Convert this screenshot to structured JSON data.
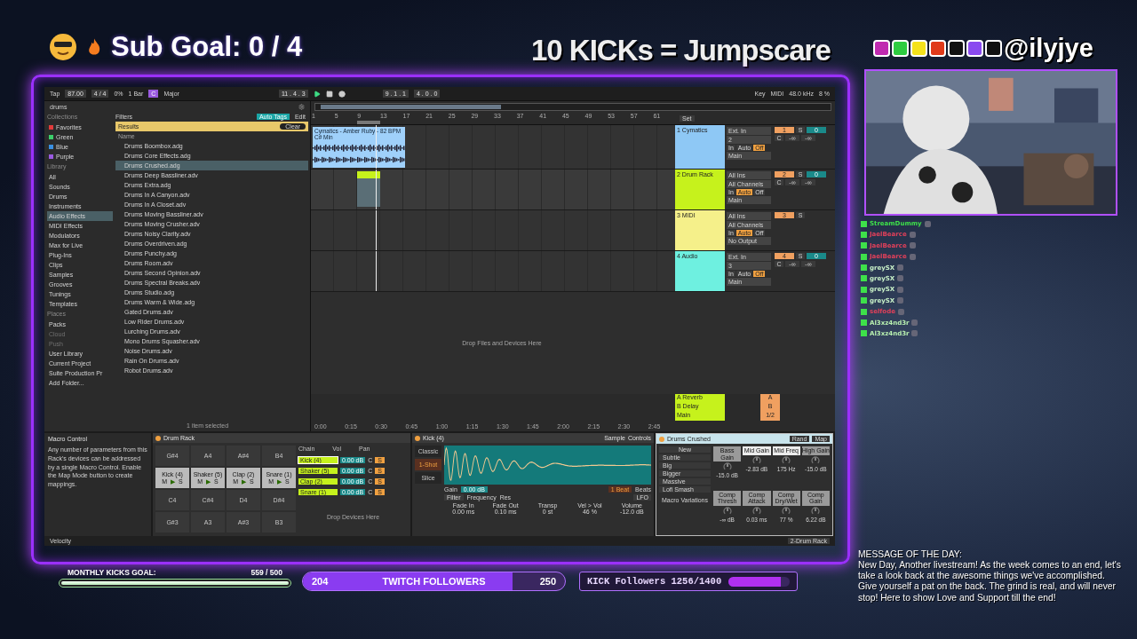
{
  "overlay": {
    "sub_goal": "Sub Goal:  0 / 4",
    "headline": "10 KICKs = Jumpscare",
    "handle": "@ilyjye"
  },
  "transport": {
    "tap": "Tap",
    "tempo": "87.00",
    "signature": "4 / 4",
    "swing": "0%",
    "quantize": "1 Bar",
    "key": "C",
    "scale": "Major",
    "position": "11 .  4 .  3",
    "loop_start": "9 .  1 .  1",
    "loop_length": "4 .  0 .  0",
    "key_label": "Key",
    "midi_label": "MIDI",
    "sample_rate": "48.0 kHz",
    "cpu": "8 %"
  },
  "browser": {
    "path": "drums",
    "filters": "Filters",
    "auto_tags": "Auto Tags",
    "edit": "Edit",
    "results": "Results",
    "clear": "Clear",
    "name_header": "Name",
    "status": "1 item selected",
    "collections_title": "Collections",
    "collections": [
      {
        "label": "Favorites",
        "color": "#e23b3b"
      },
      {
        "label": "Green",
        "color": "#3ccf6a"
      },
      {
        "label": "Blue",
        "color": "#3a8fe0"
      },
      {
        "label": "Purple",
        "color": "#9a5ae0"
      }
    ],
    "library_title": "Library",
    "library": [
      {
        "label": "All",
        "selected": false
      },
      {
        "label": "Sounds",
        "selected": false
      },
      {
        "label": "Drums",
        "selected": false
      },
      {
        "label": "Instruments",
        "selected": false
      },
      {
        "label": "Audio Effects",
        "selected": true
      },
      {
        "label": "MIDI Effects",
        "selected": false
      },
      {
        "label": "Modulators",
        "selected": false
      },
      {
        "label": "Max for Live",
        "selected": false
      },
      {
        "label": "Plug-Ins",
        "selected": false
      },
      {
        "label": "Clips",
        "selected": false
      },
      {
        "label": "Samples",
        "selected": false
      },
      {
        "label": "Grooves",
        "selected": false
      },
      {
        "label": "Tunings",
        "selected": false
      },
      {
        "label": "Templates",
        "selected": false
      }
    ],
    "places_title": "Places",
    "places": [
      {
        "label": "Packs",
        "disabled": false
      },
      {
        "label": "Cloud",
        "disabled": true
      },
      {
        "label": "Push",
        "disabled": true
      },
      {
        "label": "User Library",
        "disabled": false
      },
      {
        "label": "Current Project",
        "disabled": false
      },
      {
        "label": "Suite Production Pr",
        "disabled": false
      },
      {
        "label": "Add Folder...",
        "disabled": false
      }
    ],
    "files": [
      {
        "name": "Drums Boombox.adg",
        "selected": false
      },
      {
        "name": "Drums Core Effects.adg",
        "selected": false
      },
      {
        "name": "Drums Crushed.adg",
        "selected": true
      },
      {
        "name": "Drums Deep Bassliner.adv",
        "selected": false
      },
      {
        "name": "Drums Extra.adg",
        "selected": false
      },
      {
        "name": "Drums In A Canyon.adv",
        "selected": false
      },
      {
        "name": "Drums In A Closet.adv",
        "selected": false
      },
      {
        "name": "Drums Moving Bassliner.adv",
        "selected": false
      },
      {
        "name": "Drums Moving Crusher.adv",
        "selected": false
      },
      {
        "name": "Drums Noisy Clarity.adv",
        "selected": false
      },
      {
        "name": "Drums Overdriven.adg",
        "selected": false
      },
      {
        "name": "Drums Punchy.adg",
        "selected": false
      },
      {
        "name": "Drums Room.adv",
        "selected": false
      },
      {
        "name": "Drums Second Opinion.adv",
        "selected": false
      },
      {
        "name": "Drums Spectral Breaks.adv",
        "selected": false
      },
      {
        "name": "Drums Studio.adg",
        "selected": false
      },
      {
        "name": "Drums Warm & Wide.adg",
        "selected": false
      },
      {
        "name": "Gated Drums.adv",
        "selected": false
      },
      {
        "name": "Low Rider Drums.adv",
        "selected": false
      },
      {
        "name": "Lurching Drums.adv",
        "selected": false
      },
      {
        "name": "Mono Drums Squasher.adv",
        "selected": false
      },
      {
        "name": "Noise Drums.adv",
        "selected": false
      },
      {
        "name": "Rain On Drums.adv",
        "selected": false
      },
      {
        "name": "Robot Drums.adv",
        "selected": false
      }
    ]
  },
  "arrangement": {
    "bars": [
      "1",
      "5",
      "9",
      "13",
      "17",
      "21",
      "25",
      "29",
      "33",
      "37",
      "41",
      "45",
      "49",
      "53",
      "57",
      "61"
    ],
    "set_label": "Set",
    "drop_hint": "Drop Files and Devices Here",
    "times": [
      "0:00",
      "0:15",
      "0:30",
      "0:45",
      "1:00",
      "1:15",
      "1:30",
      "1:45",
      "2:00",
      "2:15",
      "2:30",
      "2:45"
    ],
    "tracks": [
      {
        "kind": "audio",
        "name": "1 Cymatics",
        "color": "#8ec8f5",
        "clip": "Cymatics - Amber Ruby - 82 BPM C# Min",
        "input": "Ext. In",
        "sub_input": "2",
        "monitor": [
          {
            "label": "In",
            "selected": false
          },
          {
            "label": "Auto",
            "selected": false
          },
          {
            "label": "Off",
            "selected": true
          }
        ],
        "output": "Main",
        "number": "1",
        "solo": "S",
        "volume": "0",
        "pan": "C",
        "peaks": [
          "-∞",
          "-∞"
        ]
      },
      {
        "kind": "midi",
        "name": "2 Drum Rack",
        "color": "#c6f21c",
        "input": "All Ins",
        "sub_input": "All Channels",
        "monitor": [
          {
            "label": "In",
            "selected": false
          },
          {
            "label": "Auto",
            "selected": true
          },
          {
            "label": "Off",
            "selected": false
          }
        ],
        "output": "Main",
        "number": "2",
        "solo": "S",
        "volume": "0",
        "pan": "C",
        "peaks": [
          "-∞",
          "-∞"
        ]
      },
      {
        "kind": "empty",
        "name": "3 MIDI",
        "color": "#f5f08a",
        "input": "All Ins",
        "sub_input": "All Channels",
        "monitor": [
          {
            "label": "In",
            "selected": false
          },
          {
            "label": "Auto",
            "selected": true
          },
          {
            "label": "Off",
            "selected": false
          }
        ],
        "output": "No Output",
        "number": "3",
        "solo": "S"
      },
      {
        "kind": "empty",
        "name": "4 Audio",
        "color": "#6ef0e0",
        "input": "Ext. In",
        "sub_input": "3",
        "monitor": [
          {
            "label": "In",
            "selected": false
          },
          {
            "label": "Auto",
            "selected": false
          },
          {
            "label": "Off",
            "selected": true
          }
        ],
        "output": "Main",
        "number": "4",
        "solo": "S",
        "volume": "0",
        "pan": "C",
        "peaks": [
          "-∞",
          "-∞"
        ]
      }
    ],
    "returns": [
      {
        "name": "A Reverb",
        "number": "A"
      },
      {
        "name": "B Delay",
        "number": "B"
      },
      {
        "name": "Main",
        "number": "1/2"
      }
    ]
  },
  "devices": {
    "info_title": "Macro Control",
    "info_text": "Any number of parameters from this Rack's devices can be addressed by a single Macro Control. Enable the Map Mode button to create mappings.",
    "rack": {
      "title": "Drum Rack",
      "pad_rows": [
        [
          {
            "label": "G#4",
            "loaded": false
          },
          {
            "label": "A4",
            "loaded": false
          },
          {
            "label": "A#4",
            "loaded": false
          },
          {
            "label": "B4",
            "loaded": false
          }
        ],
        [
          {
            "label": "Kick (4)",
            "loaded": true,
            "buttons": [
              "M",
              "▶",
              "S"
            ]
          },
          {
            "label": "Shaker (5)",
            "loaded": true,
            "buttons": [
              "M",
              "▶",
              "S"
            ]
          },
          {
            "label": "Clap (2)",
            "loaded": true,
            "buttons": [
              "M",
              "▶",
              "S"
            ]
          },
          {
            "label": "Snare (1)",
            "loaded": true,
            "buttons": [
              "M",
              "▶",
              "S"
            ]
          }
        ],
        [
          {
            "label": "C4",
            "loaded": false
          },
          {
            "label": "C#4",
            "loaded": false
          },
          {
            "label": "D4",
            "loaded": false
          },
          {
            "label": "D#4",
            "loaded": false
          }
        ],
        [
          {
            "label": "G#3",
            "loaded": false
          },
          {
            "label": "A3",
            "loaded": false
          },
          {
            "label": "A#3",
            "loaded": false
          },
          {
            "label": "B3",
            "loaded": false
          }
        ]
      ],
      "chain_headers": [
        "Chain",
        "Vol",
        "Pan"
      ],
      "chains": [
        {
          "name": "Kick (4)",
          "selected": true,
          "volume": "0.00 dB",
          "pan": "C",
          "solo": "S"
        },
        {
          "name": "Shaker (5)",
          "selected": false,
          "volume": "0.00 dB",
          "pan": "C",
          "solo": "S"
        },
        {
          "name": "Clap (2)",
          "selected": false,
          "volume": "0.00 dB",
          "pan": "C",
          "solo": "S"
        },
        {
          "name": "Snare (1)",
          "selected": false,
          "volume": "0.00 dB",
          "pan": "C",
          "solo": "S"
        }
      ],
      "drop_hint": "Drop Devices Here"
    },
    "simpler": {
      "title": "Kick (4)",
      "modes": [
        {
          "label": "Classic",
          "selected": false
        },
        {
          "label": "1-Shot",
          "selected": true
        },
        {
          "label": "Slice",
          "selected": false
        }
      ],
      "tabs": [
        "Sample",
        "Controls"
      ],
      "gain_label": "Gain",
      "gain": "0.00 dB",
      "filter": "Filter",
      "filter_params": [
        "Frequency",
        "Res"
      ],
      "lfo": "LFO",
      "beats": "1 Beat",
      "beats_unit": "Beats",
      "params": [
        {
          "label": "Fade In",
          "value": "0.00 ms"
        },
        {
          "label": "Fade Out",
          "value": "0.10 ms"
        },
        {
          "label": "Transp",
          "value": "0 st"
        },
        {
          "label": "Vel > Vol",
          "value": "46 %"
        },
        {
          "label": "Volume",
          "value": "-12.0 dB"
        }
      ]
    },
    "crushed": {
      "title": "Drums Crushed",
      "new": "New",
      "rand": "Rand",
      "map": "Map",
      "variations": [
        "Subtle",
        "Big",
        "Bigger",
        "Massive",
        "Lofi Smash"
      ],
      "variations_label": "Macro Variations",
      "macros": [
        {
          "label": "Bass Gain",
          "value": "-15.0 dB",
          "selected": false
        },
        {
          "label": "Mid Gain",
          "value": "-2.83 dB",
          "selected": true
        },
        {
          "label": "Mid Freq",
          "value": "175 Hz",
          "selected": true
        },
        {
          "label": "High Gain",
          "value": "-15.0 dB",
          "selected": false
        },
        {
          "label": "Comp Thresh",
          "value": "-∞ dB",
          "selected": false
        },
        {
          "label": "Comp Attack",
          "value": "0.03 ms",
          "selected": false
        },
        {
          "label": "Comp Dry/Wet",
          "value": "77 %",
          "selected": false
        },
        {
          "label": "Comp Gain",
          "value": "6.22 dB",
          "selected": false
        }
      ]
    }
  },
  "status_bar": {
    "left": "Velocity",
    "track": "2-Drum Rack"
  },
  "chat": [
    {
      "name": "StreamDummy",
      "color": "#3ee04a"
    },
    {
      "name": "JaelBearce",
      "color": "#e0405a"
    },
    {
      "name": "JaelBearce",
      "color": "#e0405a"
    },
    {
      "name": "JaelBearce",
      "color": "#e0405a"
    },
    {
      "name": "greySX",
      "color": "#c8f0c8"
    },
    {
      "name": "greySX",
      "color": "#c8f0c8"
    },
    {
      "name": "greySX",
      "color": "#c8f0c8"
    },
    {
      "name": "greySX",
      "color": "#c8f0c8"
    },
    {
      "name": "selfode",
      "color": "#e0405a"
    },
    {
      "name": "Al3xz4nd3r",
      "color": "#b8f0b0"
    },
    {
      "name": "Al3xz4nd3r",
      "color": "#b8f0b0"
    }
  ],
  "message": {
    "title": "MESSAGE OF THE DAY:",
    "text": "New Day, Another livestream! As the week comes to an end, let's take a look back at the awesome things we've accomplished. Give yourself a pat on the back. The grind is real, and will never stop! Here to show Love and Support till the end!"
  },
  "goals": {
    "monthly": {
      "label": "MONTHLY KICKS GOAL:",
      "count": "559 / 500",
      "level": 1
    },
    "twitch": {
      "start": "204",
      "label": "TWITCH FOLLOWERS",
      "end": "250",
      "level": 0.8
    },
    "kick": {
      "label": "KICK Followers 1256/1400",
      "level": 0.85
    }
  }
}
